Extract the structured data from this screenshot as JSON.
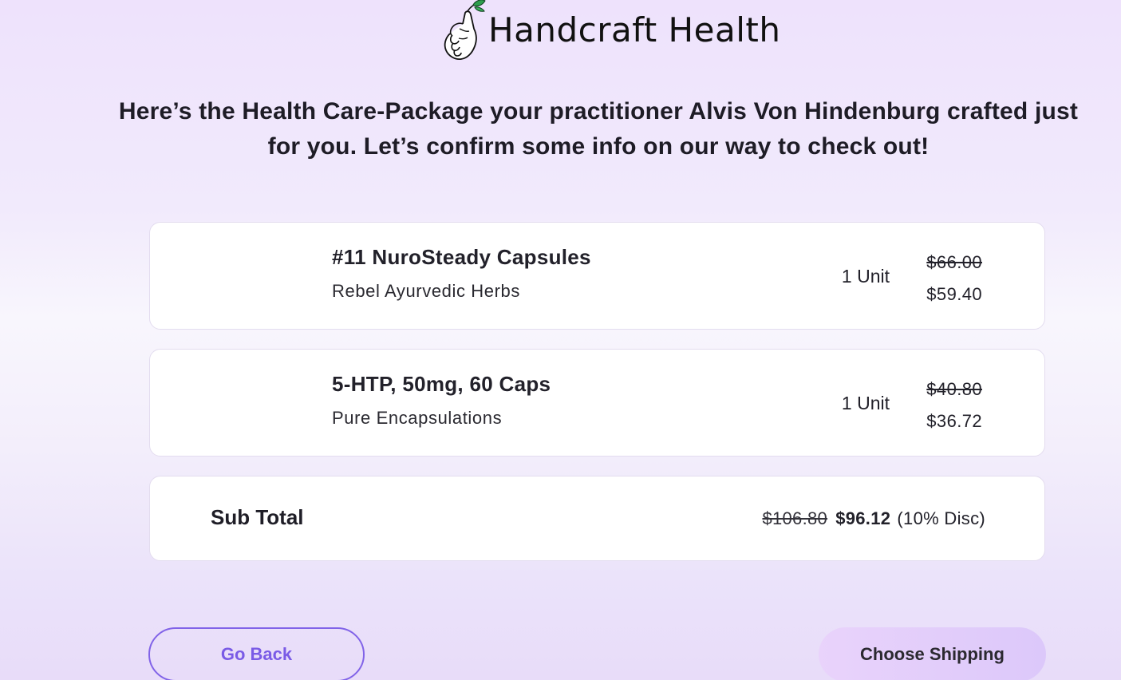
{
  "brand": {
    "name": "Handcraft Health",
    "logo_icon": "hand-holding-sprout-icon"
  },
  "intro": {
    "text": "Here’s the Health Care-Package your practitioner Alvis Von Hindenburg crafted just for you. Let’s confirm some info on our way to check out!"
  },
  "items": [
    {
      "name": "#11 NuroSteady Capsules",
      "brand": "Rebel Ayurvedic Herbs",
      "quantity": "1 Unit",
      "original_price": "$66.00",
      "price": "$59.40"
    },
    {
      "name": "5-HTP, 50mg, 60 Caps",
      "brand": "Pure Encapsulations",
      "quantity": "1 Unit",
      "original_price": "$40.80",
      "price": "$36.72"
    }
  ],
  "subtotal": {
    "label": "Sub Total",
    "original": "$106.80",
    "total": "$96.12",
    "discount": "(10% Disc)"
  },
  "actions": {
    "back_label": "Go Back",
    "next_label": "Choose Shipping"
  },
  "colors": {
    "accent": "#7a5be6",
    "primary_button": "#e3cdfb",
    "background": "#f1eafc",
    "sprout": "#2e9e4d"
  }
}
